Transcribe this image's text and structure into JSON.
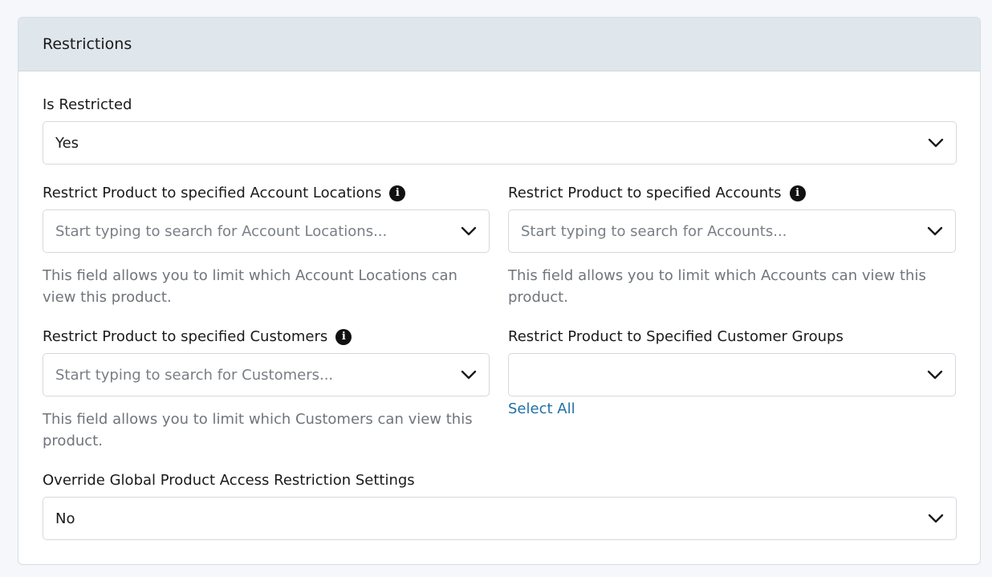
{
  "card": {
    "title": "Restrictions"
  },
  "is_restricted": {
    "label": "Is Restricted",
    "value": "Yes"
  },
  "account_locations": {
    "label": "Restrict Product to specified Account Locations",
    "placeholder": "Start typing to search for Account Locations...",
    "help": "This field allows you to limit which Account Locations can view this product."
  },
  "accounts": {
    "label": "Restrict Product to specified Accounts",
    "placeholder": "Start typing to search for Accounts...",
    "help": "This field allows you to limit which Accounts can view this product."
  },
  "customers": {
    "label": "Restrict Product to specified Customers",
    "placeholder": "Start typing to search for Customers...",
    "help": "This field allows you to limit which Customers can view this product."
  },
  "customer_groups": {
    "label": "Restrict Product to Specified Customer Groups",
    "value": "",
    "select_all_label": "Select All"
  },
  "override_global": {
    "label": "Override Global Product Access Restriction Settings",
    "value": "No"
  },
  "icons": {
    "info": "i"
  },
  "colors": {
    "header_bg": "#dfe6ec",
    "link": "#2070a8",
    "help_text": "#70757b"
  }
}
